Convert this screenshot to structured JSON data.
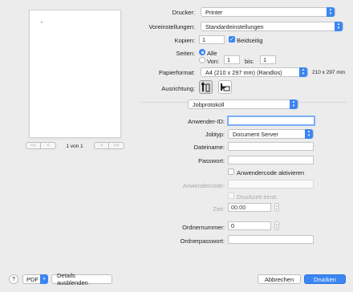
{
  "preview": {
    "page_info": "1 von 1",
    "nav_first": "<<",
    "nav_prev": "<",
    "nav_next": ">",
    "nav_last": ">>"
  },
  "printer": {
    "label": "Drucker:",
    "value": "Printer"
  },
  "presets": {
    "label": "Voreinstellungen:",
    "value": "Standardeinstellungen"
  },
  "copies": {
    "label": "Kopien:",
    "value": "1",
    "duplex_label": "Beidseitig",
    "duplex_checked": true
  },
  "pages": {
    "label": "Seiten:",
    "all_label": "Alle",
    "from_label": "Von:",
    "from_value": "1",
    "to_label": "bis:",
    "to_value": "1"
  },
  "paper": {
    "label": "Papierformat:",
    "value": "A4 (210 x 297 mm) (Randlos)",
    "size_text": "210 x 297 mm"
  },
  "orientation": {
    "label": "Ausrichtung:"
  },
  "section": {
    "value": "Jobprotokoll"
  },
  "job": {
    "user_id_label": "Anwender-ID:",
    "user_id_value": "",
    "type_label": "Jobtyp:",
    "type_value": "Document Server",
    "filename_label": "Dateiname:",
    "filename_value": "",
    "password_label": "Passwort:",
    "password_value": "",
    "usercode_check_label": "Anwendercode aktivieren",
    "usercode_label": "Anwendercode:",
    "usercode_value": "",
    "printtime_check_label": "Druckzeit einst.",
    "time_label": "Zeit:",
    "time_value": "00:00",
    "folder_no_label": "Ordnernummer:",
    "folder_no_value": "0",
    "folder_pw_label": "Ordnerpasswort:",
    "folder_pw_value": ""
  },
  "footer": {
    "help": "?",
    "pdf": "PDF",
    "hide_details": "Details ausblenden",
    "cancel": "Abbrechen",
    "print": "Drucken"
  },
  "colors": {
    "accent": "#3b86f2",
    "background": "#ececec"
  }
}
